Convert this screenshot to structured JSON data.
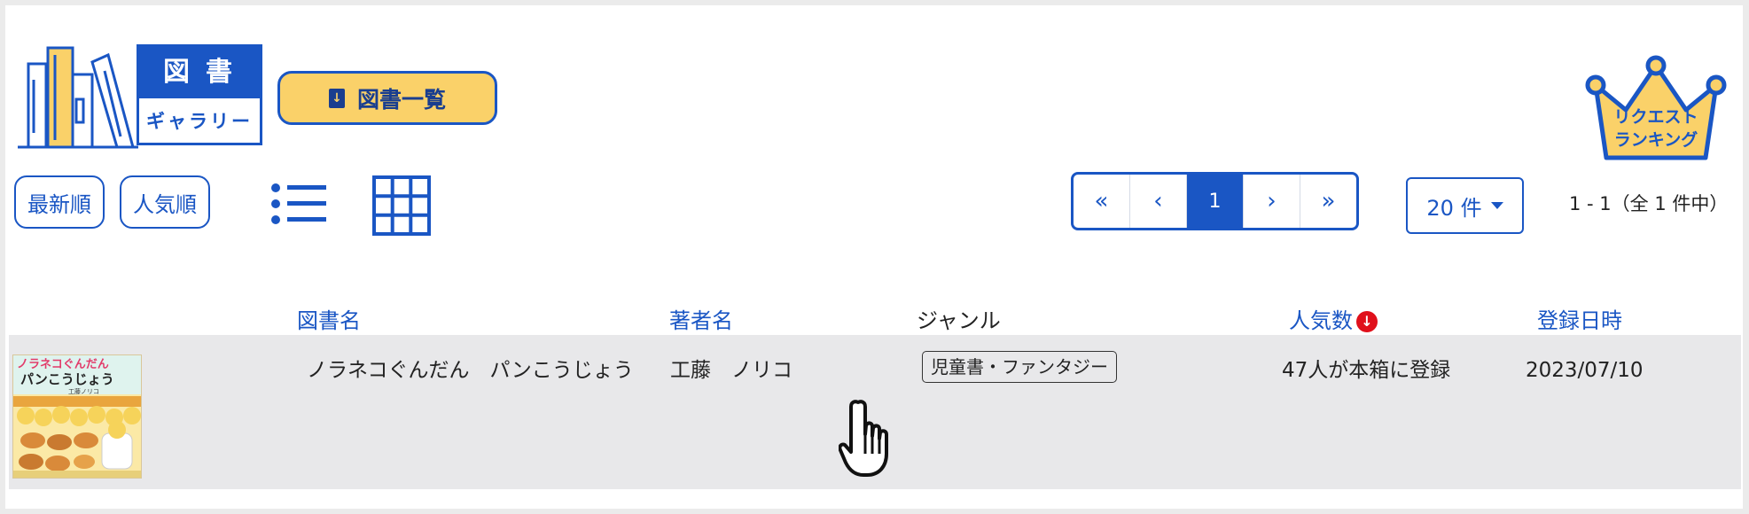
{
  "logo": {
    "top": "図書",
    "bottom": "ギャラリー"
  },
  "list_button": {
    "label": "図書一覧"
  },
  "ranking": {
    "line1": "リクエスト",
    "line2": "ランキング"
  },
  "sort": {
    "newest": "最新順",
    "popular": "人気順"
  },
  "pagination": {
    "first": "«",
    "prev": "‹",
    "current": "1",
    "next": "›",
    "last": "»"
  },
  "per_page": "20 件",
  "result_count": "1 - 1（全 1 件中）",
  "table": {
    "headers": {
      "title": "図書名",
      "author": "著者名",
      "genre": "ジャンル",
      "popularity": "人気数",
      "registered": "登録日時"
    },
    "sort_indicator": "↓",
    "rows": [
      {
        "title": "ノラネコぐんだん　パンこうじょう",
        "author": "工藤　ノリコ",
        "genre": "児童書・ファンタジー",
        "popularity": "47人が本箱に登録",
        "registered": "2023/07/10",
        "cover_title_line1": "ノラネコぐんだん",
        "cover_title_line2": "パンこうじょう",
        "cover_author": "工藤ノリコ"
      }
    ]
  },
  "colors": {
    "primary": "#1a56c4",
    "accent_yellow": "#fad169",
    "row_bg": "#e8e8ea",
    "sort_red": "#e0101b"
  }
}
